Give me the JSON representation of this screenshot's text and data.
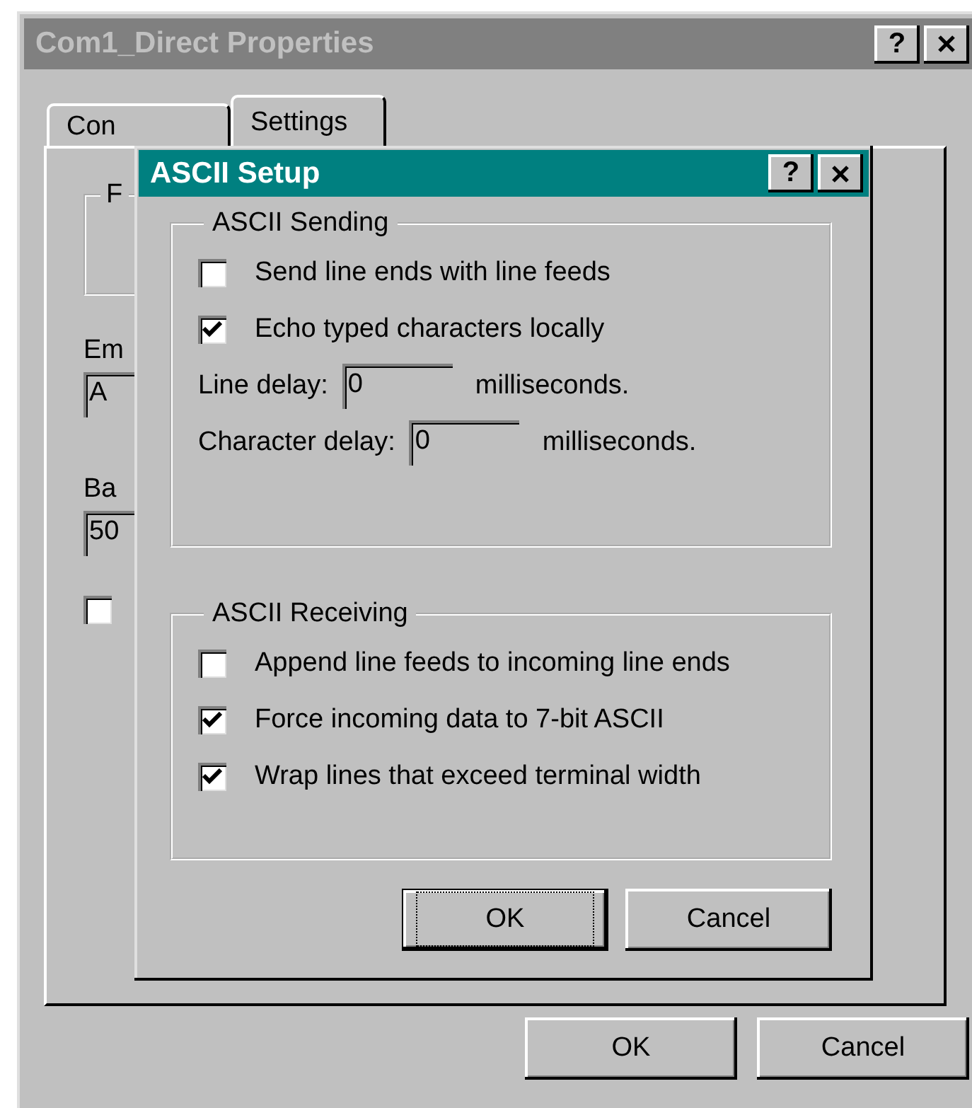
{
  "window": {
    "title": "Com1_Direct Properties",
    "help": "?"
  },
  "tabs": [
    {
      "label": "Con",
      "selected": false
    },
    {
      "label": "Settings",
      "selected": true
    }
  ],
  "page": {
    "group_label": "F",
    "emulation_label": "Em",
    "emulation_value": "A",
    "backscroll_label": "Ba",
    "backscroll_value": "50",
    "option_checked": false
  },
  "buttons": [
    "OK",
    "Cancel"
  ],
  "dialog": {
    "title": "ASCII Setup",
    "help": "?",
    "sending": {
      "title": "ASCII Sending",
      "options": [
        {
          "label": "Send line ends with line feeds",
          "checked": false
        },
        {
          "label": "Echo typed characters locally",
          "checked": true
        }
      ],
      "delays": [
        {
          "label": "Line delay:",
          "value": "0",
          "unit": "milliseconds."
        },
        {
          "label": "Character delay:",
          "value": "0",
          "unit": "milliseconds."
        }
      ]
    },
    "receiving": {
      "title": "ASCII Receiving",
      "options": [
        {
          "label": "Append line feeds to incoming line ends",
          "checked": false
        },
        {
          "label": "Force incoming data to 7-bit ASCII",
          "checked": true
        },
        {
          "label": "Wrap lines that exceed terminal width",
          "checked": true
        }
      ]
    },
    "buttons": [
      {
        "label": "OK",
        "default": true
      },
      {
        "label": "Cancel",
        "default": false
      }
    ]
  }
}
